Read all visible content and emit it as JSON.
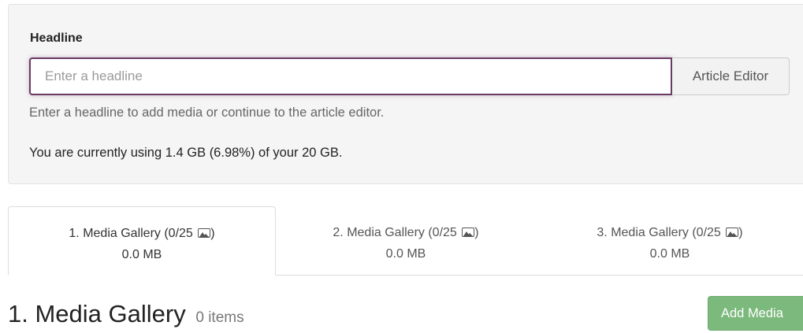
{
  "headline_form": {
    "label": "Headline",
    "input_placeholder": "Enter a headline",
    "input_value": "",
    "article_editor_button": "Article Editor",
    "help_text": "Enter a headline to add media or continue to the article editor.",
    "usage_text": "You are currently using 1.4 GB (6.98%) of your 20 GB."
  },
  "tabs": [
    {
      "title": "1. Media Gallery (0/25",
      "close": ")",
      "size": "0.0 MB",
      "active": true
    },
    {
      "title": "2. Media Gallery (0/25",
      "close": ")",
      "size": "0.0 MB",
      "active": false
    },
    {
      "title": "3. Media Gallery (0/25",
      "close": ")",
      "size": "0.0 MB",
      "active": false
    }
  ],
  "gallery": {
    "title": "1. Media Gallery",
    "item_count": "0 items",
    "add_media_button": "Add Media"
  },
  "colors": {
    "input_focus_border": "#6a3b63",
    "add_media_bg": "#7cb97c",
    "well_bg": "#f5f5f5"
  },
  "icons": {
    "tab_icon": "image-icon"
  }
}
